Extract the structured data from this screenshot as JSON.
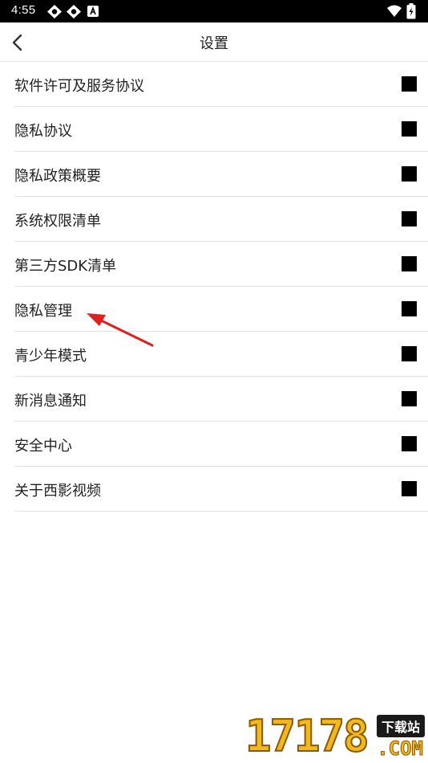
{
  "status_bar": {
    "time": "4:55",
    "icons": [
      "settings-notify-icon",
      "settings-notify-icon",
      "a-app-icon",
      "wifi-icon",
      "battery-icon"
    ]
  },
  "header": {
    "title": "设置",
    "back_icon": "chevron-left-icon"
  },
  "settings": {
    "items": [
      {
        "label": "软件许可及服务协议"
      },
      {
        "label": "隐私协议"
      },
      {
        "label": "隐私政策概要"
      },
      {
        "label": "系统权限清单"
      },
      {
        "label": "第三方SDK清单"
      },
      {
        "label": "隐私管理"
      },
      {
        "label": "青少年模式"
      },
      {
        "label": "新消息通知"
      },
      {
        "label": "安全中心"
      },
      {
        "label": "关于西影视频"
      }
    ],
    "marker_color": "#000000"
  },
  "annotation": {
    "arrow_color": "#e02020"
  },
  "watermark": {
    "digits": "17178",
    "badge": "下载站",
    "suffix": ".COM"
  }
}
